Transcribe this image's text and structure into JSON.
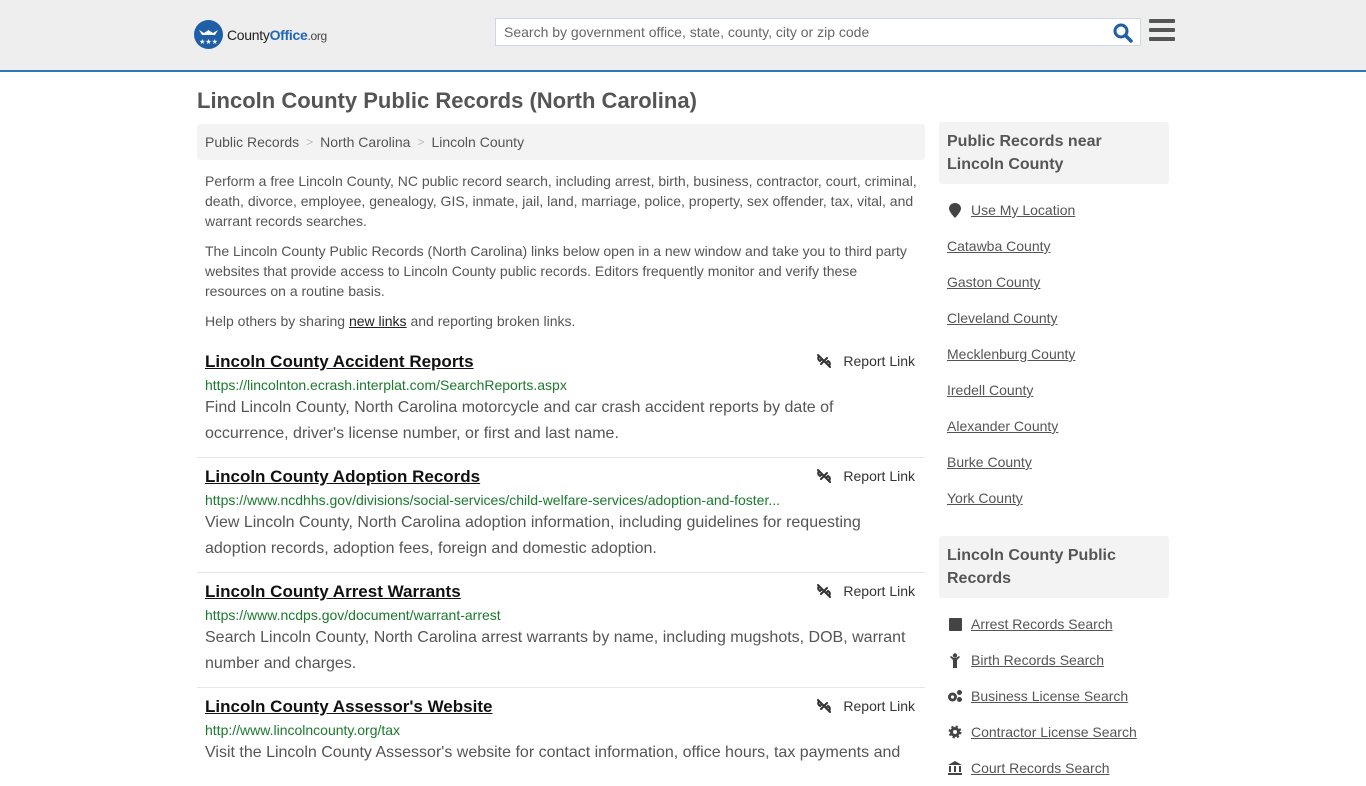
{
  "header": {
    "logo": {
      "county": "County",
      "office": "Office",
      "org": ".org"
    },
    "search": {
      "placeholder": "Search by government office, state, county, city or zip code",
      "value": ""
    },
    "colors": {
      "accent": "#2b78b4",
      "brand": "#1f5fa6",
      "url_green": "#1a7a2e"
    }
  },
  "page": {
    "title": "Lincoln County Public Records (North Carolina)",
    "breadcrumb": [
      "Public Records",
      "North Carolina",
      "Lincoln County"
    ],
    "intro": {
      "p1": "Perform a free Lincoln County, NC public record search, including arrest, birth, business, contractor, court, criminal, death, divorce, employee, genealogy, GIS, inmate, jail, land, marriage, police, property, sex offender, tax, vital, and warrant records searches.",
      "p2": "The Lincoln County Public Records (North Carolina) links below open in a new window and take you to third party websites that provide access to Lincoln County public records. Editors frequently monitor and verify these resources on a routine basis.",
      "p3_before": "Help others by sharing ",
      "p3_link": "new links",
      "p3_after": " and reporting broken links."
    }
  },
  "records": [
    {
      "title": "Lincoln County Accident Reports",
      "url": "https://lincolnton.ecrash.interplat.com/SearchReports.aspx",
      "description": "Find Lincoln County, North Carolina motorcycle and car crash accident reports by date of occurrence, driver's license number, or first and last name.",
      "report_label": "Report Link"
    },
    {
      "title": "Lincoln County Adoption Records",
      "url": "https://www.ncdhhs.gov/divisions/social-services/child-welfare-services/adoption-and-foster...",
      "description": "View Lincoln County, North Carolina adoption information, including guidelines for requesting adoption records, adoption fees, foreign and domestic adoption.",
      "report_label": "Report Link"
    },
    {
      "title": "Lincoln County Arrest Warrants",
      "url": "https://www.ncdps.gov/document/warrant-arrest",
      "description": "Search Lincoln County, North Carolina arrest warrants by name, including mugshots, DOB, warrant number and charges.",
      "report_label": "Report Link"
    },
    {
      "title": "Lincoln County Assessor's Website",
      "url": "http://www.lincolncounty.org/tax",
      "description": "Visit the Lincoln County Assessor's website for contact information, office hours, tax payments and",
      "report_label": "Report Link"
    }
  ],
  "sidebar": {
    "nearby": {
      "heading": "Public Records near Lincoln County",
      "use_location": "Use My Location",
      "counties": [
        "Catawba County",
        "Gaston County",
        "Cleveland County",
        "Mecklenburg County",
        "Iredell County",
        "Alexander County",
        "Burke County",
        "York County"
      ]
    },
    "county_records": {
      "heading": "Lincoln County Public Records",
      "items": [
        {
          "label": "Arrest Records Search",
          "icon": "square-icon"
        },
        {
          "label": "Birth Records Search",
          "icon": "child-icon"
        },
        {
          "label": "Business License Search",
          "icon": "cogs-icon"
        },
        {
          "label": "Contractor License Search",
          "icon": "gear-icon"
        },
        {
          "label": "Court Records Search",
          "icon": "courthouse-icon"
        }
      ]
    }
  }
}
